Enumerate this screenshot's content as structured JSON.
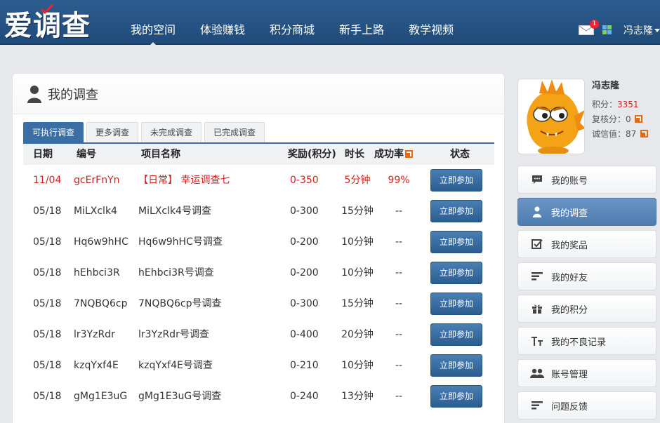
{
  "header": {
    "logo_text": "爱调查",
    "nav": [
      {
        "label": "我的空间"
      },
      {
        "label": "体验赚钱"
      },
      {
        "label": "积分商城"
      },
      {
        "label": "新手上路"
      },
      {
        "label": "教学视频"
      }
    ],
    "mail_badge": "1",
    "username": "冯志隆"
  },
  "main": {
    "title": "我的调查",
    "tabs": [
      {
        "label": "可执行调查"
      },
      {
        "label": "更多调查"
      },
      {
        "label": "未完成调查"
      },
      {
        "label": "已完成调查"
      }
    ],
    "columns": {
      "date": "日期",
      "code": "编号",
      "name": "项目名称",
      "reward": "奖励(积分)",
      "duration": "时长",
      "rate": "成功率",
      "status": "状态"
    },
    "rows": [
      {
        "date": "11/04",
        "code": "gcErFnYn",
        "name": "【日常】 幸运调查七",
        "reward": "0-350",
        "duration": "5分钟",
        "rate": "99%",
        "action": "立即参加"
      },
      {
        "date": "05/18",
        "code": "MiLXclk4",
        "name": "MiLXclk4号调查",
        "reward": "0-300",
        "duration": "15分钟",
        "rate": "--",
        "action": "立即参加"
      },
      {
        "date": "05/18",
        "code": "Hq6w9hHC",
        "name": "Hq6w9hHC号调查",
        "reward": "0-200",
        "duration": "10分钟",
        "rate": "--",
        "action": "立即参加"
      },
      {
        "date": "05/18",
        "code": "hEhbci3R",
        "name": "hEhbci3R号调查",
        "reward": "0-200",
        "duration": "10分钟",
        "rate": "--",
        "action": "立即参加"
      },
      {
        "date": "05/18",
        "code": "7NQBQ6cp",
        "name": "7NQBQ6cp号调查",
        "reward": "0-300",
        "duration": "15分钟",
        "rate": "--",
        "action": "立即参加"
      },
      {
        "date": "05/18",
        "code": "lr3YzRdr",
        "name": "lr3YzRdr号调查",
        "reward": "0-400",
        "duration": "20分钟",
        "rate": "--",
        "action": "立即参加"
      },
      {
        "date": "05/18",
        "code": "kzqYxf4E",
        "name": "kzqYxf4E号调查",
        "reward": "0-210",
        "duration": "10分钟",
        "rate": "--",
        "action": "立即参加"
      },
      {
        "date": "05/18",
        "code": "gMg1E3uG",
        "name": "gMg1E3uG号调查",
        "reward": "0-240",
        "duration": "13分钟",
        "rate": "--",
        "action": "立即参加"
      }
    ]
  },
  "profile": {
    "name": "冯志隆",
    "points_label": "积分：",
    "points": "3351",
    "review_label": "复核分：",
    "review": "0",
    "credit_label": "诚信值：",
    "credit": "87"
  },
  "menu": [
    {
      "label": "我的账号",
      "icon": "chat-icon"
    },
    {
      "label": "我的调查",
      "icon": "person-icon"
    },
    {
      "label": "我的奖品",
      "icon": "checkbox-icon"
    },
    {
      "label": "我的好友",
      "icon": "lines-icon"
    },
    {
      "label": "我的积分",
      "icon": "gift-icon"
    },
    {
      "label": "我的不良记录",
      "icon": "tt-icon"
    },
    {
      "label": "账号管理",
      "icon": "group-icon"
    },
    {
      "label": "问题反馈",
      "icon": "lines-icon"
    }
  ],
  "colors": {
    "header_bg": "#245483",
    "accent": "#3a6ea5",
    "highlight_red": "#d42020"
  }
}
